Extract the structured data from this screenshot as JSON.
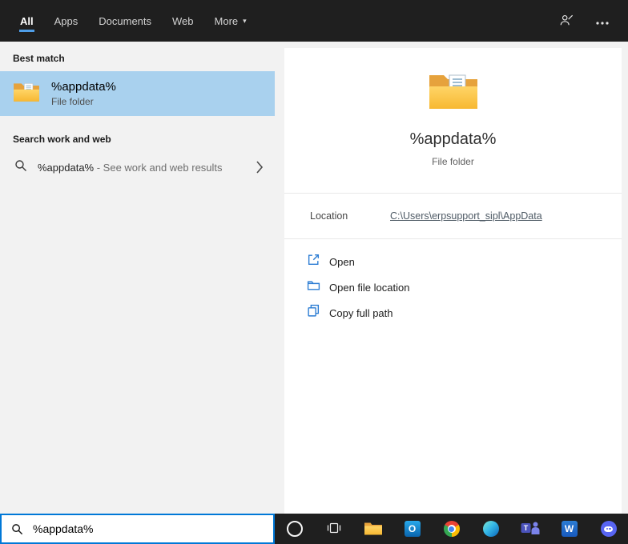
{
  "colors": {
    "accent": "#0078d7",
    "topbar_bg": "#1f1f1f",
    "selected_item_bg": "#a9d1ee",
    "tab_underline": "#4f9ee8",
    "action_icon_blue": "#2b7cd3",
    "folder_yellow": "#f7b832",
    "link_color": "#4e5a65"
  },
  "topbar": {
    "tabs": [
      {
        "label": "All",
        "selected": true
      },
      {
        "label": "Apps",
        "selected": false
      },
      {
        "label": "Documents",
        "selected": false
      },
      {
        "label": "Web",
        "selected": false
      },
      {
        "label": "More",
        "selected": false,
        "dropdown": true
      }
    ],
    "icons": [
      "feedback-icon",
      "more-options-icon"
    ]
  },
  "left_panel": {
    "best_match_label": "Best match",
    "best_match_item": {
      "title": "%appdata%",
      "subtitle": "File folder",
      "icon": "folder-icon"
    },
    "web_section_label": "Search work and web",
    "web_item": {
      "query": "%appdata%",
      "suffix": " - See work and web results",
      "icon": "search-icon"
    }
  },
  "preview": {
    "icon": "folder-icon",
    "title": "%appdata%",
    "subtitle": "File folder",
    "location_label": "Location",
    "location_value": "C:\\Users\\erpsupport_sipl\\AppData",
    "actions": [
      {
        "label": "Open",
        "icon": "open-icon"
      },
      {
        "label": "Open file location",
        "icon": "open-file-location-icon"
      },
      {
        "label": "Copy full path",
        "icon": "copy-icon"
      }
    ]
  },
  "search_input": {
    "value": "%appdata%",
    "icon": "search-icon"
  },
  "taskbar": {
    "icons": [
      "cortana",
      "task-view",
      "file-explorer",
      "outlook",
      "chrome",
      "edge",
      "teams",
      "word",
      "discord"
    ],
    "outlook_letter": "O",
    "teams_letter": "T",
    "word_letter": "W"
  }
}
